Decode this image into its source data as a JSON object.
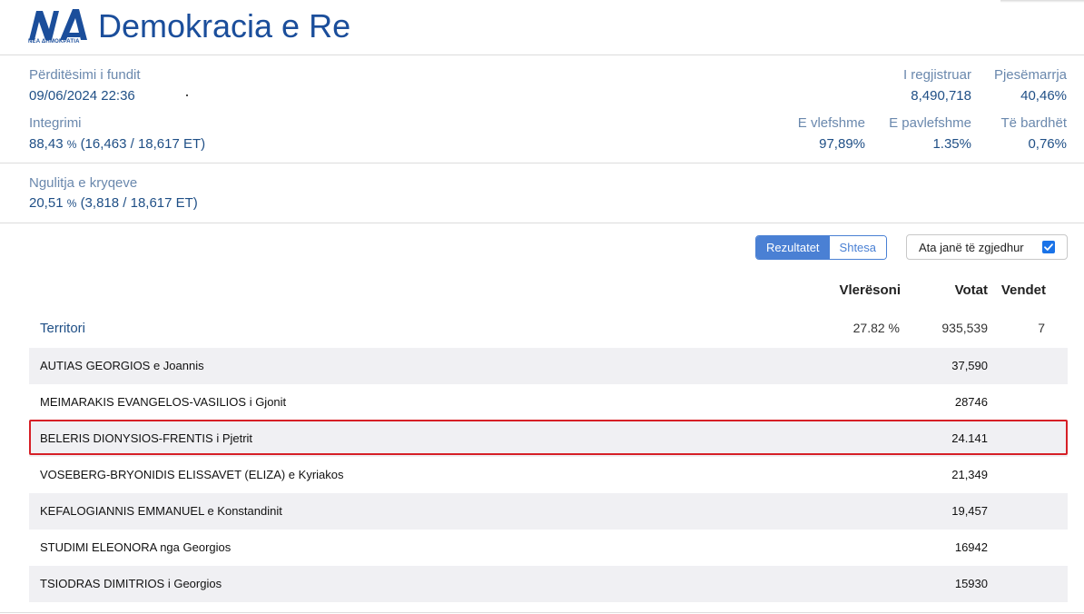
{
  "header": {
    "title": "Demokracia e Re",
    "logo_text": "ΝΔ",
    "logo_sub": "ΝΕΑ ΔΗΜΟΚΡΑΤΙΑ"
  },
  "stats": {
    "last_update_label": "Përditësimi i fundit",
    "last_update_value": "09/06/2024 22:36",
    "registered_label": "I regjistruar",
    "registered_value": "8,490,718",
    "turnout_label": "Pjesëmarrja",
    "turnout_value": "40,46%",
    "integration_label": "Integrimi",
    "integration_pct": "88,43",
    "integration_unit": "%",
    "integration_detail": "(16,463 / 18,617 ET)",
    "valid_label": "E vlefshme",
    "valid_value": "97,89%",
    "invalid_label": "E pavlefshme",
    "invalid_value": "1.35%",
    "blank_label": "Të bardhët",
    "blank_value": "0,76%",
    "crosses_label": "Ngulitja e kryqeve",
    "crosses_pct": "20,51",
    "crosses_unit": "%",
    "crosses_detail": "(3,818 / 18,617 ET)"
  },
  "controls": {
    "tab_results": "Rezultatet",
    "tab_extra": "Shtesa",
    "elected_label": "Ata janë të zgjedhur",
    "elected_checked": true
  },
  "table": {
    "col_score": "Vlerësoni",
    "col_votes": "Votat",
    "col_seats": "Vendet",
    "territory": {
      "name": "Territori",
      "score": "27.82 %",
      "votes": "935,539",
      "seats": "7"
    },
    "candidates": [
      {
        "name": "AUTIAS GEORGIOS e Joannis",
        "votes": "37,590"
      },
      {
        "name": "MEIMARAKIS EVANGELOS-VASILIOS i Gjonit",
        "votes": "28746"
      },
      {
        "name": "BELERIS DIONYSIOS-FRENTIS i Pjetrit",
        "votes": "24.141"
      },
      {
        "name": "VOSEBERG-BRYONIDIS ELISSAVET (ELIZA) e Kyriakos",
        "votes": "21,349"
      },
      {
        "name": "KEFALOGIANNIS EMMANUEL e Konstandinit",
        "votes": "19,457"
      },
      {
        "name": "STUDIMI ELEONORA nga Georgios",
        "votes": "16942"
      },
      {
        "name": "TSIODRAS DIMITRIOS i Georgios",
        "votes": "15930"
      }
    ]
  },
  "colors": {
    "brand": "#1b4e9b",
    "accent": "#4a80d4",
    "highlight": "#d61f26"
  }
}
